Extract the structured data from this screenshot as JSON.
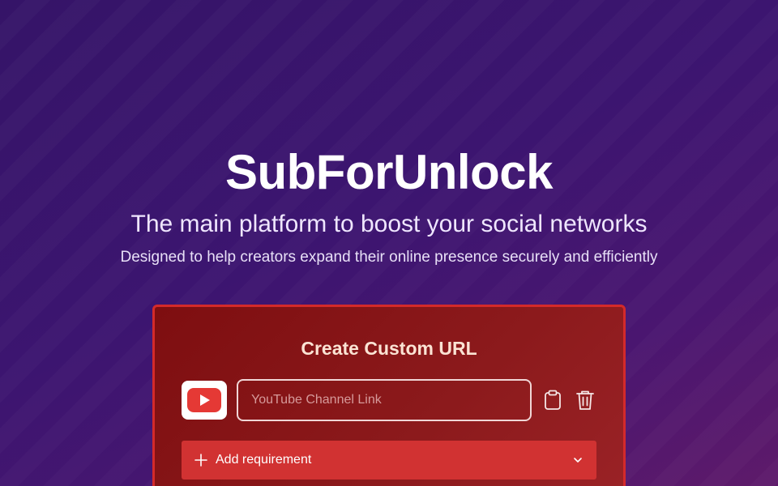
{
  "hero": {
    "title": "SubForUnlock",
    "subtitle": "The main platform to boost your social networks",
    "tagline": "Designed to help creators expand their online presence securely and efficiently"
  },
  "card": {
    "title": "Create Custom URL",
    "platform_icon": "youtube-icon",
    "channel_input": {
      "placeholder": "YouTube Channel Link",
      "value": ""
    },
    "actions": [
      "clipboard-icon",
      "trash-icon"
    ],
    "add_requirement": {
      "label": "Add requirement",
      "icon": "plus-icon",
      "toggle_icon": "chevron-down-icon"
    }
  },
  "colors": {
    "background": "#3c1570",
    "card": "#8a1618",
    "card_border": "#d42a2a",
    "button": "#d13232",
    "youtube_red": "#e53935"
  }
}
